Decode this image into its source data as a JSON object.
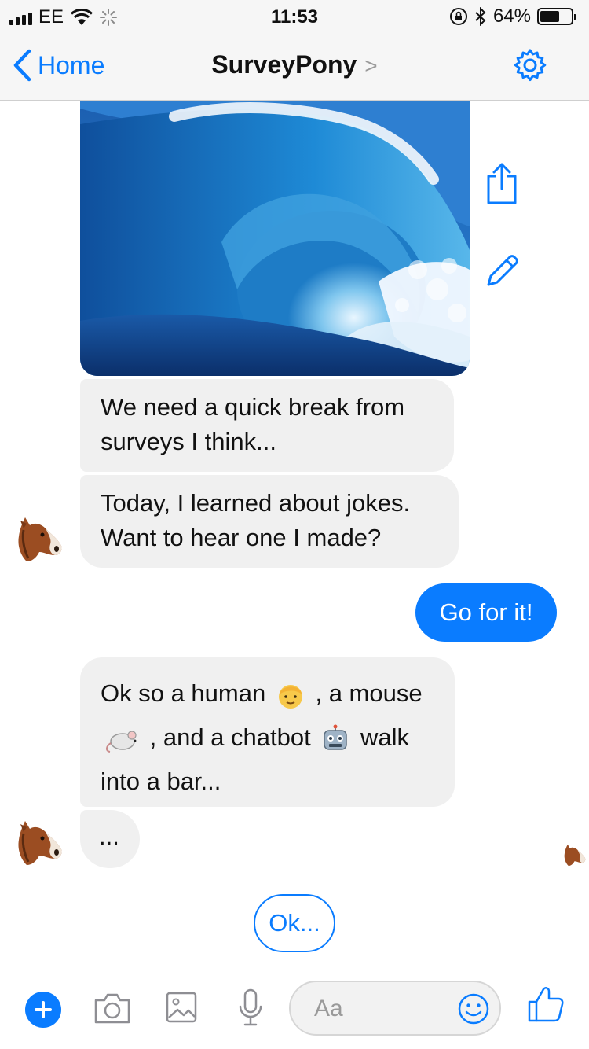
{
  "status_bar": {
    "carrier": "EE",
    "time": "11:53",
    "battery": "64%",
    "battery_level": 0.64
  },
  "nav": {
    "back_label": "Home",
    "title": "SurveyPony",
    "title_chevron": ">"
  },
  "colors": {
    "accent": "#0a7cff",
    "incoming_bubble": "#f0f0f0",
    "bar_bg": "#f6f6f6"
  },
  "messages": {
    "m1": [
      "We need a quick break from",
      "surveys I think..."
    ],
    "m2": [
      "Today, I learned about jokes.",
      "Want to hear one I made?"
    ],
    "outgoing": "Go for it!",
    "m3": {
      "line1_a": "Ok so a human",
      "line1_b": ", a mouse",
      "line2_a": ", and a chatbot",
      "line2_b": "walk",
      "line3": "into a bar..."
    },
    "typing": "..."
  },
  "quick_reply": "Ok...",
  "composer": {
    "placeholder": "Aa"
  },
  "icons": [
    "wifi-icon",
    "loading-icon",
    "rotation-lock-icon",
    "bluetooth-icon",
    "back-chevron-icon",
    "gear-icon",
    "share-icon",
    "pencil-icon",
    "plus-icon",
    "camera-icon",
    "image-icon",
    "microphone-icon",
    "emoji-icon",
    "thumbs-up-icon",
    "human-emoji",
    "mouse-emoji",
    "robot-emoji",
    "horse-avatar"
  ]
}
